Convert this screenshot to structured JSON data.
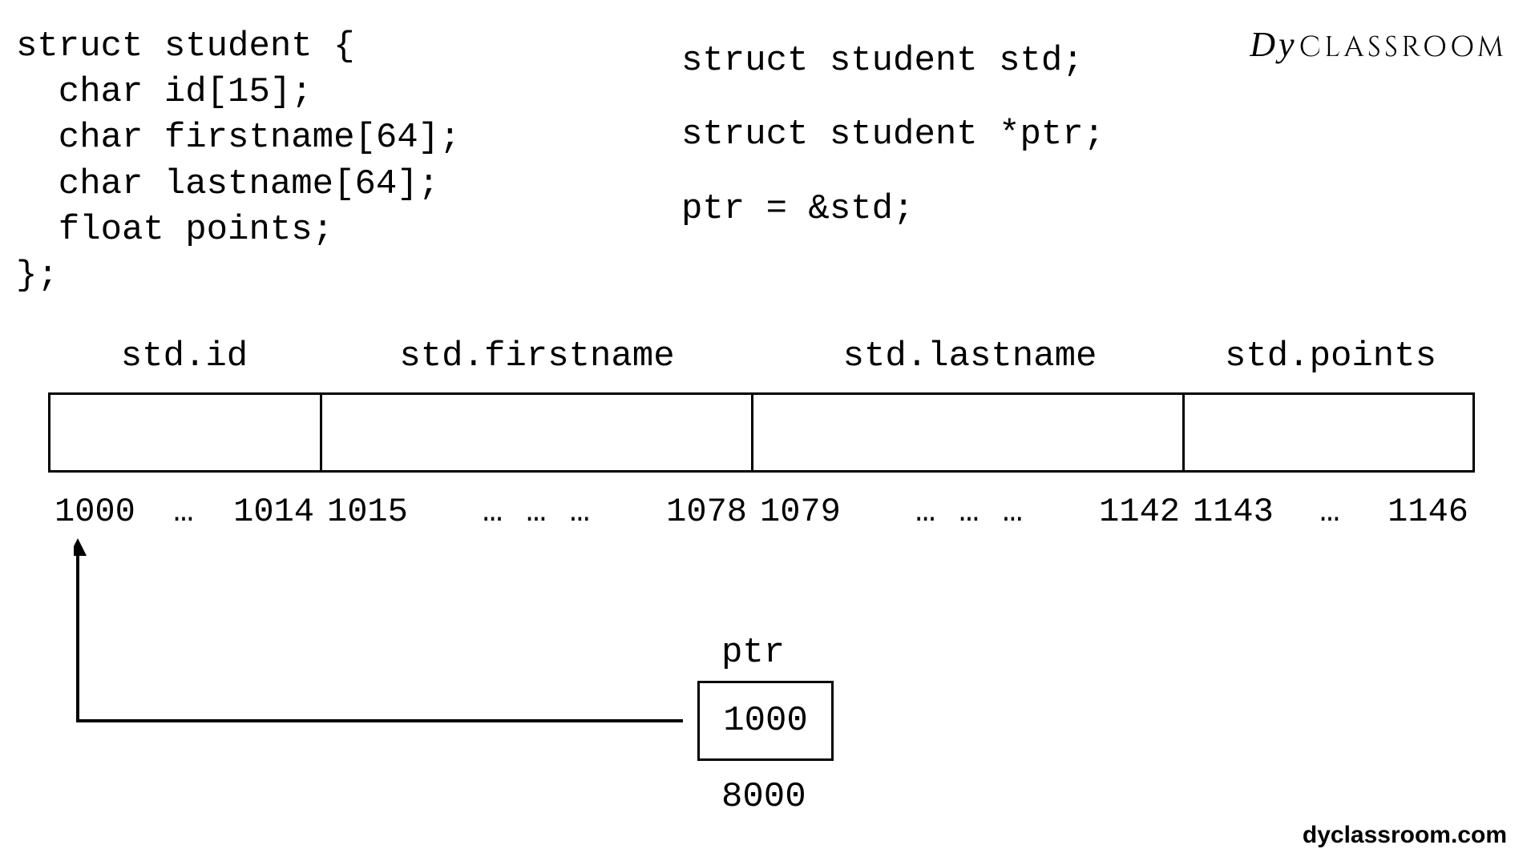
{
  "code_left": "struct student {\n  char id[15];\n  char firstname[64];\n  char lastname[64];\n  float points;\n};",
  "code_right": "struct student std;\nstruct student *ptr;\nptr = &std;",
  "logo": {
    "d": "Dy",
    "rest": "CLASSROOM"
  },
  "fields": {
    "id": "std.id",
    "firstname": "std.firstname",
    "lastname": "std.lastname",
    "points": "std.points"
  },
  "addresses": {
    "id": {
      "start": "1000",
      "mid": "…",
      "end": "1014"
    },
    "fn": {
      "start": "1015",
      "mid": "…  …  …",
      "end": "1078"
    },
    "ln": {
      "start": "1079",
      "mid": "…  …  …",
      "end": "1142"
    },
    "pts": {
      "start": "1143",
      "mid": "…",
      "end": "1146"
    }
  },
  "ptr": {
    "label": "ptr",
    "value": "1000",
    "address": "8000"
  },
  "footer": "dyclassroom.com"
}
